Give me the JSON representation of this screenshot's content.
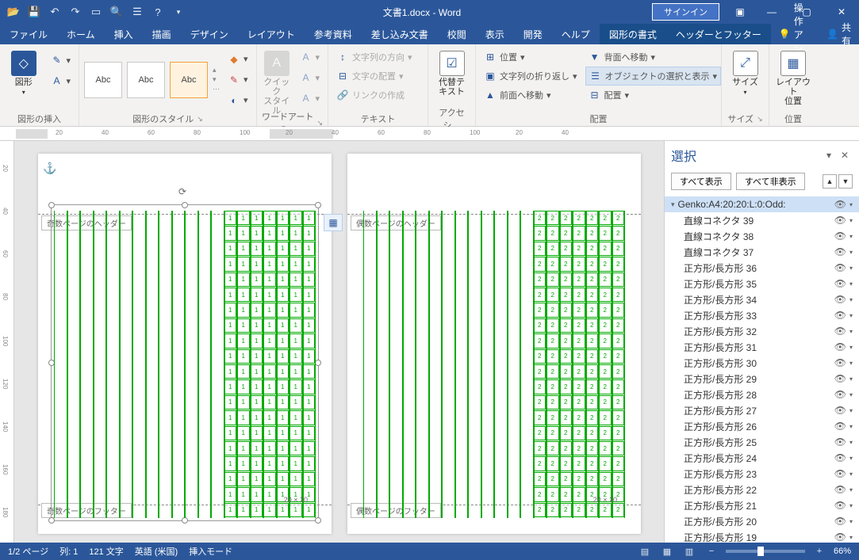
{
  "titlebar": {
    "title": "文書1.docx - Word",
    "signin": "サインイン"
  },
  "tabs": {
    "items": [
      "ファイル",
      "ホーム",
      "挿入",
      "描画",
      "デザイン",
      "レイアウト",
      "参考資料",
      "差し込み文書",
      "校閲",
      "表示",
      "開発",
      "ヘルプ",
      "図形の書式",
      "ヘッダーとフッター"
    ],
    "active": 12,
    "tell": "操作アシス",
    "share": "共有"
  },
  "ribbon": {
    "shapes_btn": "図形",
    "group_insert": "図形の挿入",
    "group_styles": "図形のスタイル",
    "group_wordart": "ワードアートの…",
    "group_text": "テキスト",
    "group_access": "アクセシ…",
    "group_arrange": "配置",
    "group_size": "サイズ",
    "group_pos": "位置",
    "style_label": "Abc",
    "quick_style": "クイック\nスタイル",
    "text_dir": "文字列の方向",
    "text_align": "文字の配置",
    "link": "リンクの作成",
    "alt_text": "代替テ\nキスト",
    "pos": "位置",
    "wrap": "文字列の折り返し",
    "fwd": "前面へ移動",
    "back": "背面へ移動",
    "selpane": "オブジェクトの選択と表示",
    "align": "配置",
    "size": "サイズ",
    "layout_pos": "レイアウト\n位置"
  },
  "selection_pane": {
    "title": "選択",
    "show_all": "すべて表示",
    "hide_all": "すべて非表示",
    "root": "Genko:A4:20:20:L:0:Odd:",
    "items": [
      "直線コネクタ 39",
      "直線コネクタ 38",
      "直線コネクタ 37",
      "正方形/長方形 36",
      "正方形/長方形 35",
      "正方形/長方形 34",
      "正方形/長方形 33",
      "正方形/長方形 32",
      "正方形/長方形 31",
      "正方形/長方形 30",
      "正方形/長方形 29",
      "正方形/長方形 28",
      "正方形/長方形 27",
      "正方形/長方形 26",
      "正方形/長方形 25",
      "正方形/長方形 24",
      "正方形/長方形 23",
      "正方形/長方形 22",
      "正方形/長方形 21",
      "正方形/長方形 20",
      "正方形/長方形 19"
    ]
  },
  "pages": {
    "odd_header": "奇数ページのヘッダー",
    "odd_footer": "奇数ページのフッター",
    "even_header": "偶数ページのヘッダー",
    "even_footer": "偶数ページのフッター",
    "cell1": "1",
    "cell2": "2",
    "dim": "20 × 20"
  },
  "status": {
    "page": "1/2 ページ",
    "col": "列: 1",
    "words": "121 文字",
    "lang": "英語 (米国)",
    "mode": "挿入モード",
    "zoom": "66%"
  },
  "ruler": {
    "h": [
      "20",
      "40",
      "60",
      "80",
      "100",
      "20",
      "40",
      "60",
      "80",
      "100",
      "20",
      "40"
    ],
    "v": [
      "20",
      "40",
      "60",
      "80",
      "100",
      "120",
      "140",
      "160",
      "180"
    ]
  }
}
